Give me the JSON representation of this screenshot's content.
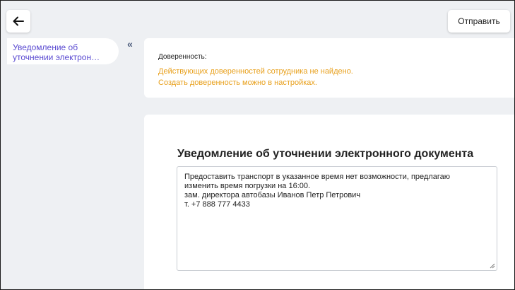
{
  "header": {
    "back_icon": "arrow-left-icon",
    "send_label": "Отправить"
  },
  "annotation": {
    "arrow_color": "#e00000"
  },
  "sidebar": {
    "items": [
      {
        "line1": "Уведомление об",
        "line2": "уточнении электрон…"
      }
    ],
    "collapse_icon": "double-chevron-left-icon",
    "collapse_glyph": "«"
  },
  "proxy": {
    "label": "Доверенность:",
    "warning_line1": "Действующих доверенностей сотрудника не найдено.",
    "warning_line2": "Создать доверенность можно в настройках.",
    "warning_color": "#e8a01c"
  },
  "document": {
    "title": "Уведомление об уточнении электронного документа",
    "text_lines": [
      "Предоставить транспорт в указанное время нет возможности, предлагаю",
      "изменить время погрузки на 16:00.",
      "зам. директора автобазы Иванов Петр Петрович",
      "т.  +7 888 777 4433"
    ]
  },
  "colors": {
    "background": "#eef0f3",
    "accent": "#5a4ad1"
  }
}
